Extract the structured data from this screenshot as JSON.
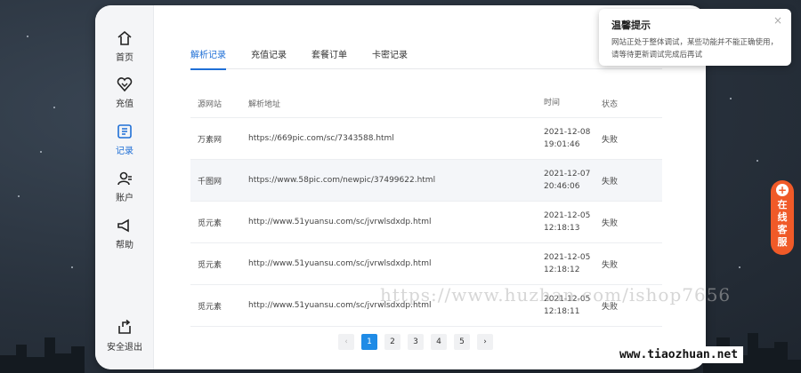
{
  "sidebar": {
    "items": [
      {
        "label": "首页",
        "icon": "home-icon"
      },
      {
        "label": "充值",
        "icon": "recharge-icon"
      },
      {
        "label": "记录",
        "icon": "records-icon"
      },
      {
        "label": "账户",
        "icon": "account-icon"
      },
      {
        "label": "帮助",
        "icon": "help-icon"
      }
    ],
    "logout": {
      "label": "安全退出",
      "icon": "logout-icon"
    }
  },
  "tabs": [
    {
      "label": "解析记录"
    },
    {
      "label": "充值记录"
    },
    {
      "label": "套餐订单"
    },
    {
      "label": "卡密记录"
    }
  ],
  "table": {
    "headers": [
      "源网站",
      "解析地址",
      "时间",
      "状态"
    ],
    "rows": [
      {
        "site": "万素网",
        "url": "https://669pic.com/sc/7343588.html",
        "date": "2021-12-08",
        "time": "19:01:46",
        "status": "失败"
      },
      {
        "site": "千图网",
        "url": "https://www.58pic.com/newpic/37499622.html",
        "date": "2021-12-07",
        "time": "20:46:06",
        "status": "失败"
      },
      {
        "site": "觅元素",
        "url": "http://www.51yuansu.com/sc/jvrwlsdxdp.html",
        "date": "2021-12-05",
        "time": "12:18:13",
        "status": "失败"
      },
      {
        "site": "觅元素",
        "url": "http://www.51yuansu.com/sc/jvrwlsdxdp.html",
        "date": "2021-12-05",
        "time": "12:18:12",
        "status": "失败"
      },
      {
        "site": "觅元素",
        "url": "http://www.51yuansu.com/sc/jvrwlsdxdp.html",
        "date": "2021-12-05",
        "time": "12:18:11",
        "status": "失败"
      }
    ]
  },
  "pagination": {
    "prev": "‹",
    "pages": [
      "1",
      "2",
      "3",
      "4",
      "5"
    ],
    "next": "›",
    "current": "1"
  },
  "notice": {
    "title": "温馨提示",
    "text": "网站正处于整体调试，某些功能并不能正确使用，请等待更新调试完成后再试",
    "close": "×"
  },
  "customer_service": {
    "plus": "+",
    "label": "在线客服"
  },
  "watermark": "https://www.huzhan.com/ishop7656",
  "site_badge": "www.tiaozhuan.net",
  "colors": {
    "accent": "#1f6fd6",
    "page_active": "#1f8be6",
    "cs_orange": "#f05a28"
  }
}
